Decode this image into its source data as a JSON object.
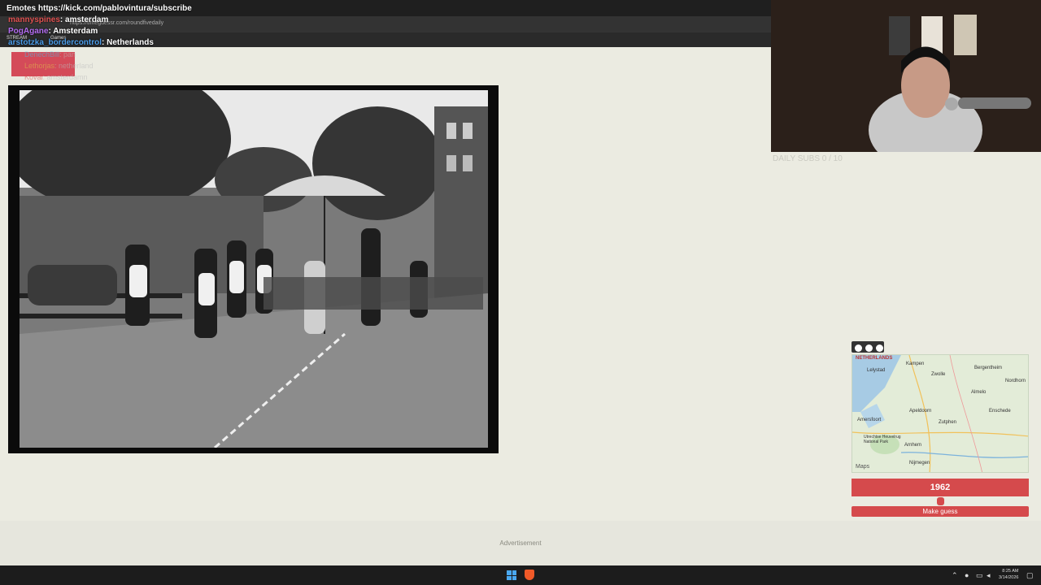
{
  "browser": {
    "url": "https://timeguessr.com/roundfivedaily",
    "bookmarks": [
      "STREAM",
      "Games"
    ]
  },
  "chat": {
    "top_banner": "Emotes https://kick.com/pablovintura/subscribe",
    "messages": [
      {
        "user": "mannyspines",
        "text": ": amsterdam",
        "user_color": "#e05252"
      },
      {
        "user": "PogAgane",
        "text": ": Amsterdam",
        "user_color": "#b36cf0"
      },
      {
        "user": "arstotzka_bordercontrol",
        "text": ": Netherlands",
        "user_color": "#4a9be8"
      },
      {
        "user": "DenechBill",
        "text": ": pan",
        "user_color": "#4ac0e8"
      },
      {
        "user": "Lethorjas",
        "text": ": netherland",
        "user_color": "#e0c04a"
      },
      {
        "user": "Koval",
        "text": ": amsterdamn",
        "user_color": "#e04a4a"
      }
    ]
  },
  "webcam": {
    "daily_subs": "DAILY SUBS 0 / 10"
  },
  "map": {
    "brand": "NETHERLANDS",
    "credit": "Maps",
    "places": [
      {
        "name": "Kampen"
      },
      {
        "name": "Zwolle"
      },
      {
        "name": "Lelystad"
      },
      {
        "name": "Bergentheim"
      },
      {
        "name": "Nordhorn"
      },
      {
        "name": "Almelo"
      },
      {
        "name": "Apeldoorn"
      },
      {
        "name": "Enschede"
      },
      {
        "name": "Amersfoort"
      },
      {
        "name": "Zutphen"
      },
      {
        "name": "Utrechtse Heuvelrug National Park"
      },
      {
        "name": "Arnhem"
      },
      {
        "name": "Nijmegen"
      }
    ]
  },
  "guess": {
    "year": "1962",
    "slider_fraction": 0.5,
    "button_label": "Make guess"
  },
  "footer": {
    "ad_label": "Advertisement"
  },
  "taskbar": {
    "time": "8:25 AM",
    "date": "3/14/2026"
  },
  "colors": {
    "accent": "#d54a4c",
    "page_bg": "#ebebe1",
    "taskbar": "#1c1c1c"
  }
}
